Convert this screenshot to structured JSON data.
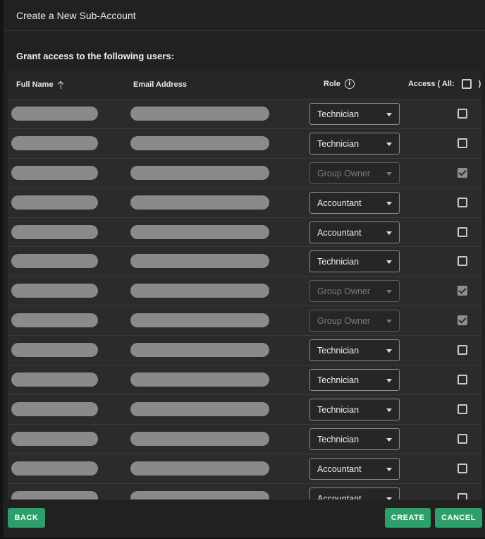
{
  "dialog": {
    "title": "Create a New Sub-Account",
    "grant_label": "Grant access to the following users:"
  },
  "table": {
    "headers": {
      "full_name": "Full Name",
      "email": "Email Address",
      "role": "Role",
      "access_prefix": "Access ( All:",
      "access_suffix": ")"
    },
    "rows": [
      {
        "role": "Technician",
        "disabled": false,
        "checked": false
      },
      {
        "role": "Technician",
        "disabled": false,
        "checked": false
      },
      {
        "role": "Group Owner",
        "disabled": true,
        "checked": true
      },
      {
        "role": "Accountant",
        "disabled": false,
        "checked": false
      },
      {
        "role": "Accountant",
        "disabled": false,
        "checked": false
      },
      {
        "role": "Technician",
        "disabled": false,
        "checked": false
      },
      {
        "role": "Group Owner",
        "disabled": true,
        "checked": true
      },
      {
        "role": "Group Owner",
        "disabled": true,
        "checked": true
      },
      {
        "role": "Technician",
        "disabled": false,
        "checked": false
      },
      {
        "role": "Technician",
        "disabled": false,
        "checked": false
      },
      {
        "role": "Technician",
        "disabled": false,
        "checked": false
      },
      {
        "role": "Technician",
        "disabled": false,
        "checked": false
      },
      {
        "role": "Accountant",
        "disabled": false,
        "checked": false
      },
      {
        "role": "Accountant",
        "disabled": false,
        "checked": false
      }
    ]
  },
  "footer": {
    "back_label": "BACK",
    "create_label": "CREATE",
    "cancel_label": "CANCEL"
  },
  "colors": {
    "accent": "#2e9e6b",
    "dialog_bg": "#212121",
    "row_bg": "#2b2b2b"
  },
  "icons": {
    "sort": "arrow-up-icon",
    "role_info": "info-icon",
    "dropdown": "caret-down-icon"
  }
}
